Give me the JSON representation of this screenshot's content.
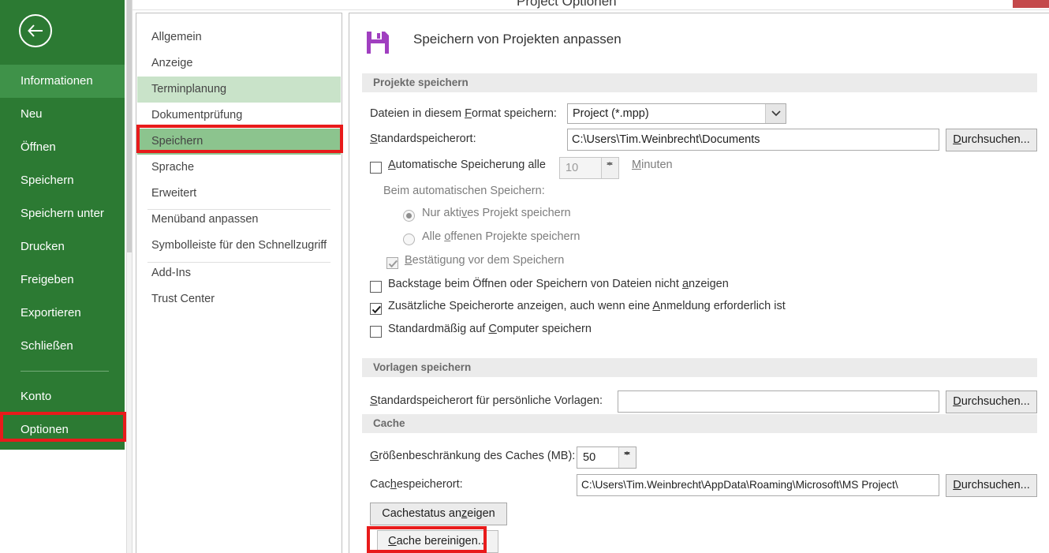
{
  "window": {
    "title": "Project Optionen",
    "close_label": ""
  },
  "backstage": {
    "back_icon": "back-arrow-icon",
    "items": [
      {
        "label": "Informationen",
        "active": true
      },
      {
        "label": "Neu",
        "active": false
      },
      {
        "label": "Öffnen",
        "active": false
      },
      {
        "label": "Speichern",
        "active": false
      },
      {
        "label": "Speichern unter",
        "active": false
      },
      {
        "label": "Drucken",
        "active": false
      },
      {
        "label": "Freigeben",
        "active": false
      },
      {
        "label": "Exportieren",
        "active": false
      },
      {
        "label": "Schließen",
        "active": false
      },
      {
        "label": "Konto",
        "active": false
      },
      {
        "label": "Optionen",
        "active": false
      }
    ]
  },
  "nav": {
    "items": [
      {
        "label": "Allgemein",
        "state": "normal"
      },
      {
        "label": "Anzeige",
        "state": "normal"
      },
      {
        "label": "Terminplanung",
        "state": "hover"
      },
      {
        "label": "Dokumentprüfung",
        "state": "normal"
      },
      {
        "label": "Speichern",
        "state": "selected"
      },
      {
        "label": "Sprache",
        "state": "normal"
      },
      {
        "label": "Erweitert",
        "state": "normal"
      },
      {
        "label": "Menüband anpassen",
        "state": "normal"
      },
      {
        "label": "Symbolleiste für den Schnellzugriff",
        "state": "normal"
      },
      {
        "label": "Add-Ins",
        "state": "normal"
      },
      {
        "label": "Trust Center",
        "state": "normal"
      }
    ]
  },
  "page": {
    "icon": "floppy-save-icon",
    "title": "Speichern von Projekten anpassen"
  },
  "sections": {
    "projects": {
      "heading": "Projekte speichern",
      "format_label_a": "Dateien in diesem ",
      "format_label_key": "F",
      "format_label_b": "ormat speichern:",
      "format_value": "Project (*.mpp)",
      "default_location_key": "S",
      "default_location_label": "tandardspeicherort:",
      "default_location_value": "C:\\Users\\Tim.Weinbrecht\\Documents",
      "autosave_key": "A",
      "autosave_label": "utomatische Speicherung alle",
      "autosave_checked": false,
      "autosave_minutes": "10",
      "minutes_key": "M",
      "minutes_label": "inuten",
      "autosave_group_label": "Beim automatischen Speichern:",
      "radio_active_a": "Nur akti",
      "radio_active_key": "v",
      "radio_active_b": "es Projekt speichern",
      "radio_active_selected": true,
      "radio_all_a": "Alle ",
      "radio_all_key": "o",
      "radio_all_b": "ffenen Projekte speichern",
      "radio_all_selected": false,
      "confirm_key": "B",
      "confirm_label": "estätigung vor dem Speichern",
      "confirm_checked": true,
      "backstage_a": "Backstage beim Öffnen oder Speichern von Dateien nicht ",
      "backstage_key": "a",
      "backstage_b": "nzeigen",
      "backstage_checked": false,
      "extra_a": "Zusätzliche Speicherorte anzeigen, auch wenn eine ",
      "extra_key": "A",
      "extra_b": "nmeldung erforderlich ist",
      "extra_checked": true,
      "computer_a": "Standardmäßig auf ",
      "computer_key": "C",
      "computer_b": "omputer speichern",
      "computer_checked": false,
      "browse_label_key": "D",
      "browse_label_rest": "urchsuchen..."
    },
    "templates": {
      "heading": "Vorlagen speichern",
      "label_key": "S",
      "label_rest": "tandardspeicherort für persönliche Vorlagen:",
      "value": "",
      "browse_label_key": "D",
      "browse_label_rest": "urchsuchen..."
    },
    "cache": {
      "heading": "Cache",
      "size_label_key": "G",
      "size_label_rest": "rößenbeschränkung des Caches (MB):",
      "size_value": "50",
      "location_label_a": "Cac",
      "location_label_key": "h",
      "location_label_b": "espeicherort:",
      "location_value": "C:\\Users\\Tim.Weinbrecht\\AppData\\Roaming\\Microsoft\\MS Project\\",
      "browse_label_key": "D",
      "browse_label_rest": "urchsuchen...",
      "status_button_a": "Cachestatus an",
      "status_button_key": "z",
      "status_button_b": "eigen",
      "clean_button_key": "C",
      "clean_button_rest": "ache bereinigen..."
    }
  },
  "colors": {
    "backstage_green": "#2c7a33",
    "backstage_active": "#3f9249",
    "nav_selected": "#8cc48e",
    "nav_hover": "#c9e3c9",
    "annotation_red": "#e81b1b",
    "close_red": "#c4494b",
    "save_icon_purple": "#a03fc0"
  }
}
